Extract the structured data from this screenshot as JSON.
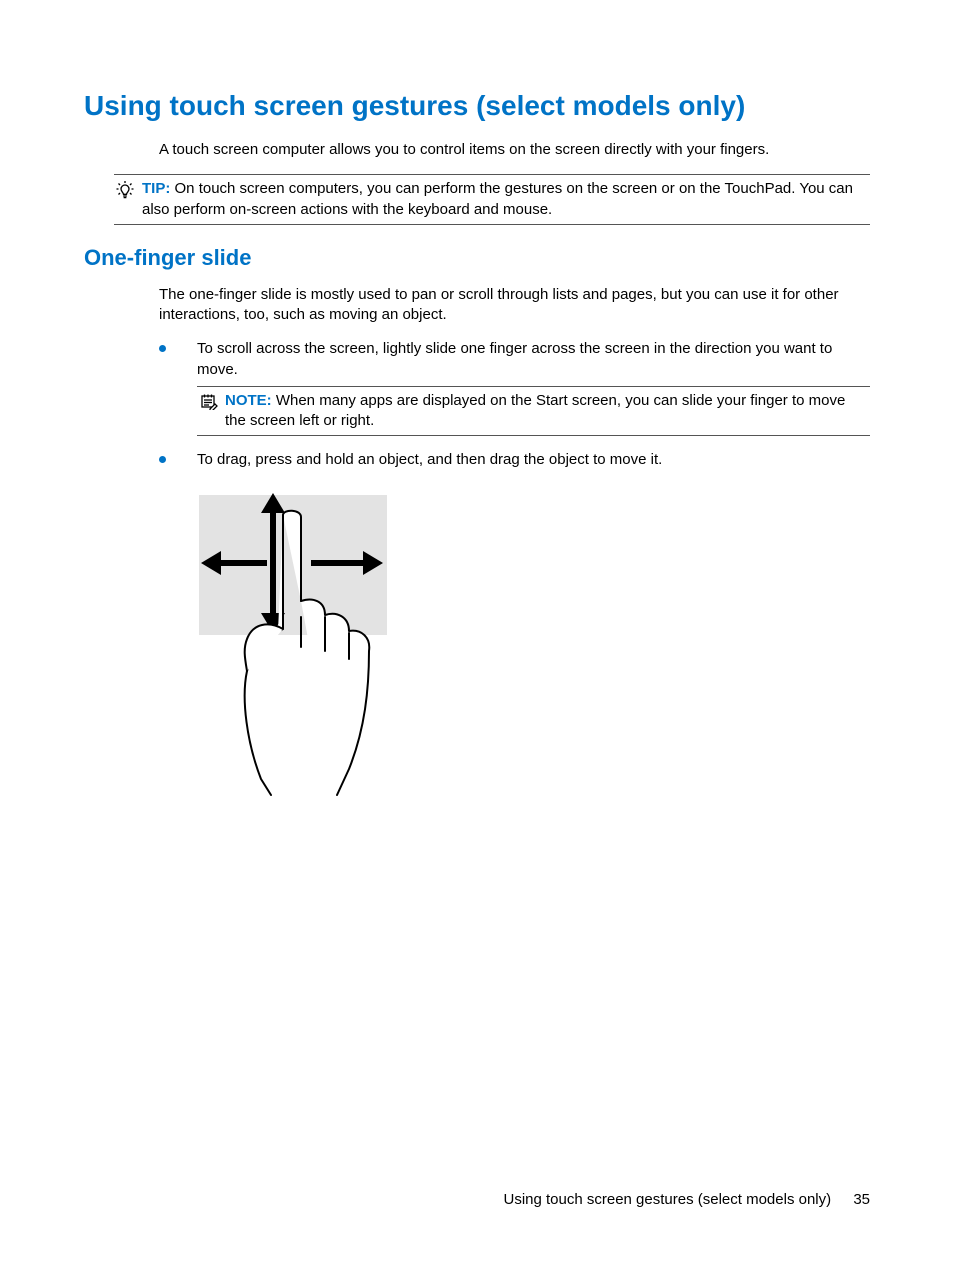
{
  "heading1": "Using touch screen gestures (select models only)",
  "intro": "A touch screen computer allows you to control items on the screen directly with your fingers.",
  "tip": {
    "label": "TIP:",
    "text": "On touch screen computers, you can perform the gestures on the screen or on the TouchPad. You can also perform on-screen actions with the keyboard and mouse."
  },
  "heading2": "One-finger slide",
  "para1": "The one-finger slide is mostly used to pan or scroll through lists and pages, but you can use it for other interactions, too, such as moving an object.",
  "bullet1": "To scroll across the screen, lightly slide one finger across the screen in the direction you want to move.",
  "note": {
    "label": "NOTE:",
    "text": "When many apps are displayed on the Start screen, you can slide your finger to move the screen left or right."
  },
  "bullet2": "To drag, press and hold an object, and then drag the object to move it.",
  "footer": {
    "title": "Using touch screen gestures (select models only)",
    "page": "35"
  }
}
